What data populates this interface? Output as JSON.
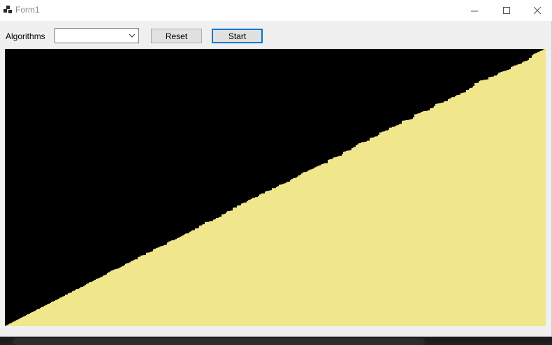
{
  "window": {
    "title": "Form1",
    "icons": {
      "app": "app-icon",
      "minimize": "minimize-icon",
      "maximize": "maximize-icon",
      "close": "close-icon"
    }
  },
  "toolbar": {
    "algorithms_label": "Algorithms",
    "algorithm_select_value": "",
    "reset_label": "Reset",
    "start_label": "Start"
  },
  "visualization": {
    "background": "#000000",
    "bar_color": "#F0E68C",
    "bar_count": 387,
    "value_range": [
      0,
      100
    ],
    "state": "sorted ascending"
  }
}
